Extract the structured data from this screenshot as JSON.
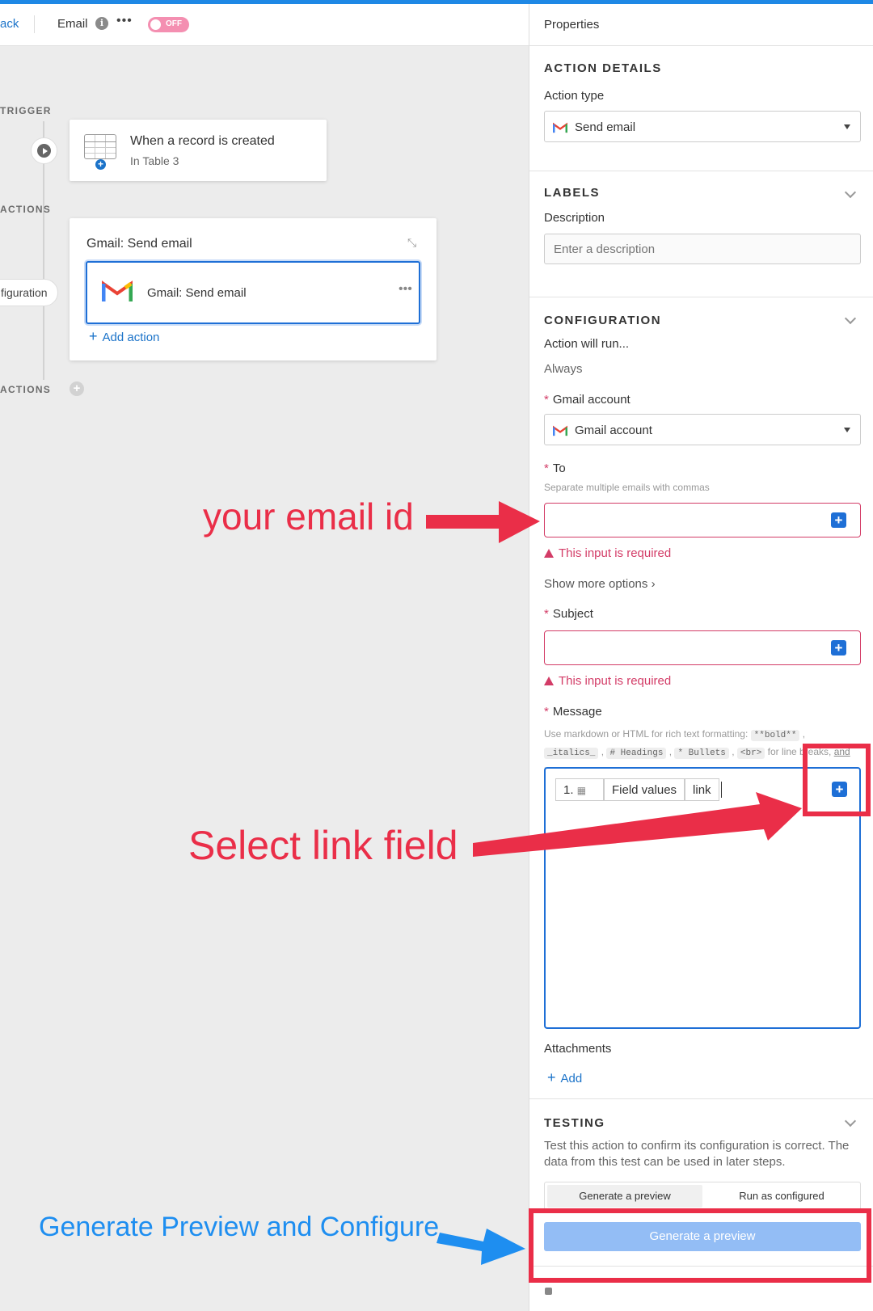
{
  "topbar": {
    "back_label": "ack",
    "workflow_title": "Email",
    "info_icon": "info-icon",
    "more_icon": "more-horizontal-icon",
    "toggle_label": "OFF",
    "toggle_color": "#f48fb1"
  },
  "canvas": {
    "trigger_label": "TRIGGER",
    "actions_label": "ACTIONS",
    "actions_label_2": "ACTIONS",
    "trigger_card": {
      "title": "When a record is created",
      "subtitle": "In Table 3"
    },
    "action_card": {
      "title": "Gmail: Send email",
      "inner_title": "Gmail: Send email",
      "add_action": "Add action"
    },
    "config_pill": "figuration"
  },
  "panel": {
    "header": "Properties",
    "action_details": {
      "heading": "ACTION DETAILS",
      "action_type_label": "Action type",
      "action_type_value": "Send email"
    },
    "labels": {
      "heading": "LABELS",
      "description_label": "Description",
      "description_placeholder": "Enter a description"
    },
    "configuration": {
      "heading": "CONFIGURATION",
      "run_label": "Action will run...",
      "run_value": "Always",
      "gmail_account_label": "Gmail account",
      "gmail_account_value": "Gmail account",
      "to_label": "To",
      "to_hint": "Separate multiple emails with commas",
      "to_error": "This input is required",
      "show_more": "Show more options",
      "subject_label": "Subject",
      "subject_error": "This input is required",
      "message_label": "Message",
      "message_hint_text": "Use markdown or HTML for rich text formatting:",
      "message_hint_codes": [
        "**bold**",
        "_italics_",
        "# Headings",
        "* Bullets",
        "<br>"
      ],
      "message_hint_tail": "for line breaks,",
      "message_hint_link": "and more",
      "message_tokens": {
        "number": "1.",
        "field": "Field values",
        "value": "link"
      },
      "attachments_label": "Attachments",
      "attachments_add": "Add"
    },
    "testing": {
      "heading": "TESTING",
      "description": "Test this action to confirm its configuration is correct. The data from this test can be used in later steps.",
      "tab_preview": "Generate a preview",
      "tab_run": "Run as configured",
      "generate_button": "Generate a preview"
    }
  },
  "annotations": {
    "email_note": "your email id",
    "link_note": "Select link field",
    "preview_note": "Generate Preview and Configure",
    "red_color": "#ea2e48",
    "blue_color": "#1e8ef0"
  }
}
